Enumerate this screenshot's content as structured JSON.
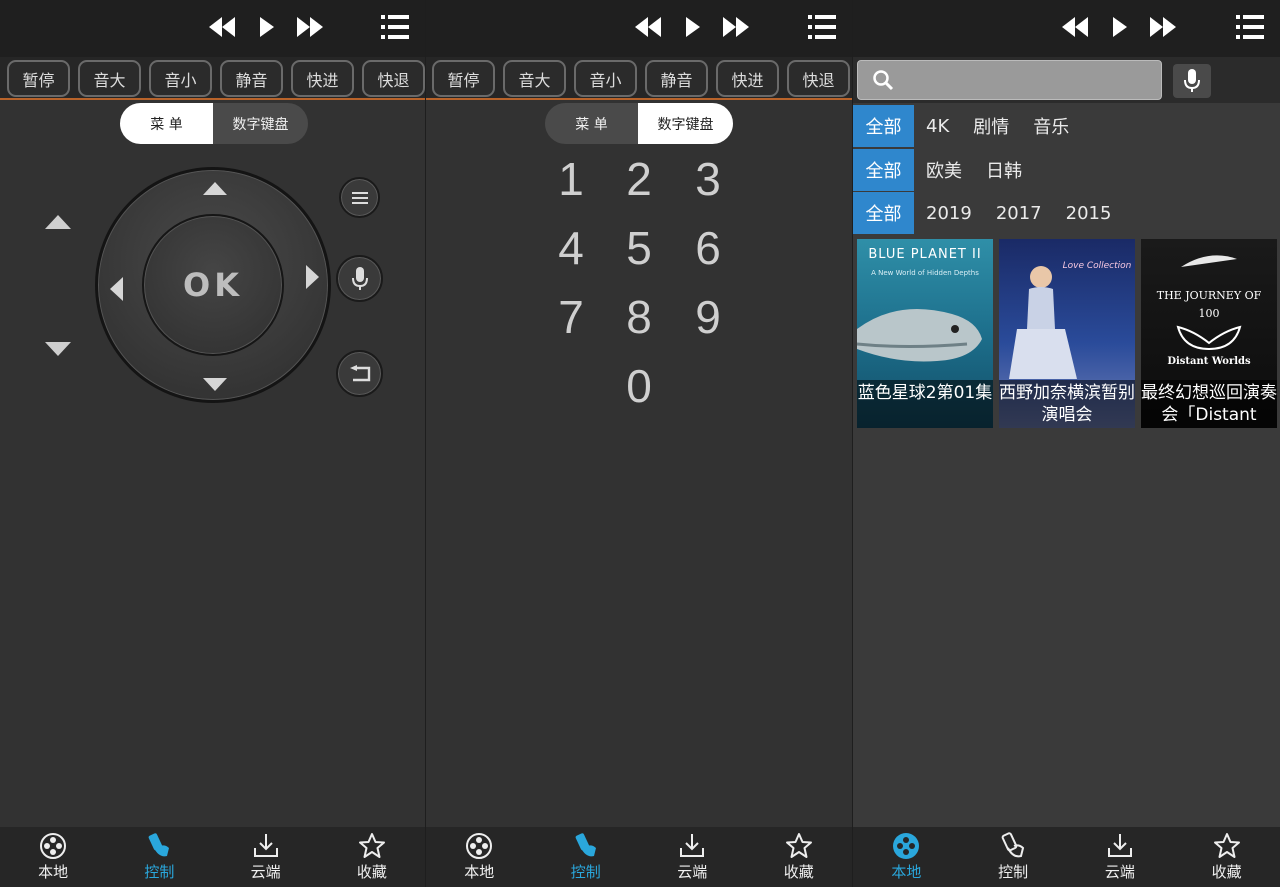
{
  "panels": [
    {
      "quick_buttons": [
        "暂停",
        "音大",
        "音小",
        "静音",
        "快进",
        "快退"
      ],
      "segment": {
        "left": "菜 单",
        "right": "数字键盘",
        "active": "left"
      },
      "remote": {
        "ok_label": "OK"
      },
      "nav": [
        {
          "label": "本地",
          "icon": "film-reel-icon",
          "active": false
        },
        {
          "label": "控制",
          "icon": "remote-hand-icon",
          "active": true
        },
        {
          "label": "云端",
          "icon": "download-icon",
          "active": false
        },
        {
          "label": "收藏",
          "icon": "star-icon",
          "active": false
        }
      ]
    },
    {
      "quick_buttons": [
        "暂停",
        "音大",
        "音小",
        "静音",
        "快进",
        "快退"
      ],
      "segment": {
        "left": "菜 单",
        "right": "数字键盘",
        "active": "right"
      },
      "keypad": [
        "1",
        "2",
        "3",
        "4",
        "5",
        "6",
        "7",
        "8",
        "9",
        "0"
      ],
      "nav": [
        {
          "label": "本地",
          "icon": "film-reel-icon",
          "active": false
        },
        {
          "label": "控制",
          "icon": "remote-hand-icon",
          "active": true
        },
        {
          "label": "云端",
          "icon": "download-icon",
          "active": false
        },
        {
          "label": "收藏",
          "icon": "star-icon",
          "active": false
        }
      ]
    },
    {
      "search": {
        "placeholder": "",
        "value": ""
      },
      "filters": [
        [
          "全部",
          "4K",
          "剧情",
          "音乐"
        ],
        [
          "全部",
          "欧美",
          "日韩"
        ],
        [
          "全部",
          "2019",
          "2017",
          "2015"
        ]
      ],
      "cards": [
        {
          "caption": "蓝色星球2第01集",
          "cover_title": "BLUE PLANET II",
          "cover_sub": "A New World of Hidden Depths"
        },
        {
          "caption": "西野加奈横滨暂别演唱会",
          "cover_title": "Love Collection",
          "cover_sub": ""
        },
        {
          "caption": "最终幻想巡回演奏会「Distant",
          "cover_title": "THE JOURNEY OF 100",
          "cover_sub": "Distant Worlds"
        }
      ],
      "nav": [
        {
          "label": "本地",
          "icon": "film-reel-icon",
          "active": true
        },
        {
          "label": "控制",
          "icon": "remote-hand-icon",
          "active": false
        },
        {
          "label": "云端",
          "icon": "download-icon",
          "active": false
        },
        {
          "label": "收藏",
          "icon": "star-icon",
          "active": false
        }
      ]
    }
  ],
  "colors": {
    "accent": "#2aa7dc",
    "filter_selected": "#2f87cd",
    "divider": "#b8632a"
  }
}
